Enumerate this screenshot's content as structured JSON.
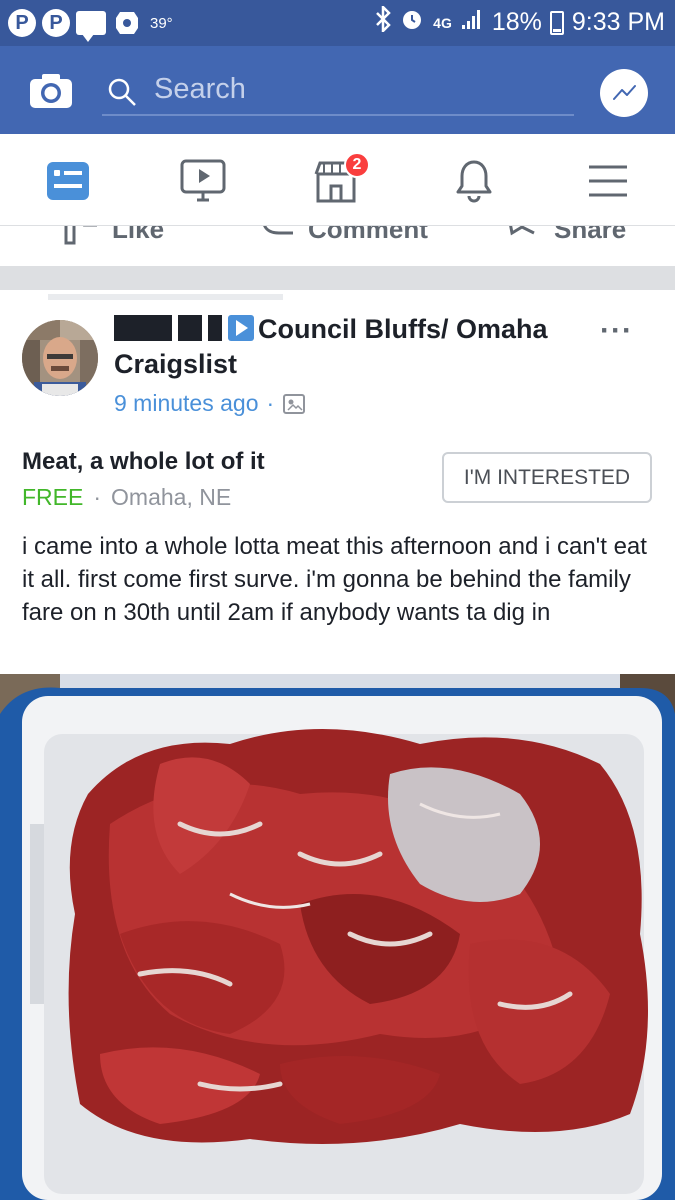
{
  "status_bar": {
    "temperature": "39°",
    "network": "4G",
    "battery": "18%",
    "time": "9:33 PM"
  },
  "search": {
    "placeholder": "Search"
  },
  "tabs": [
    {
      "icon": "news-feed-icon",
      "active": true
    },
    {
      "icon": "watch-icon"
    },
    {
      "icon": "marketplace-icon",
      "badge": "2"
    },
    {
      "icon": "notifications-icon"
    },
    {
      "icon": "menu-icon"
    }
  ],
  "previous_post_actions": {
    "like": "Like",
    "comment": "Comment",
    "share": "Share"
  },
  "post": {
    "group": "Council Bluffs/ Omaha Craigslist",
    "time": "9 minutes ago",
    "listing_title": "Meat, a whole lot of it",
    "price": "FREE",
    "location": "Omaha, NE",
    "interest_label": "I'M INTERESTED",
    "body": "i came into a whole lotta meat this afternoon and i can't eat it all.  first come first surve.  i'm gonna be behind the family fare on n 30th until 2am if anybody wants ta dig in"
  },
  "colors": {
    "brand_blue": "#4267b2",
    "status_blue": "#38589b",
    "link_blue": "#4a90d9",
    "free_green": "#42b72a",
    "badge_red": "#fa3e3e"
  }
}
